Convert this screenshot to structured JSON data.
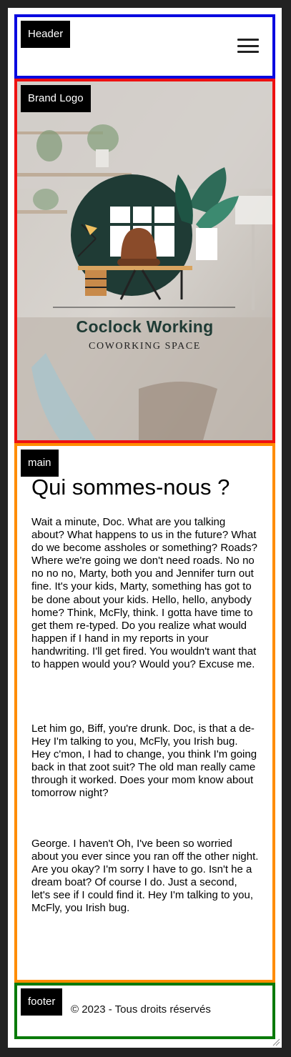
{
  "header": {
    "tag": "Header",
    "menu_icon": "hamburger-menu-icon"
  },
  "brand": {
    "tag": "Brand Logo",
    "title": "Coclock Working",
    "subtitle": "COWORKING SPACE",
    "colors": {
      "circle": "#1f3b35",
      "desk": "#d9a460",
      "chair": "#8a4b2a"
    }
  },
  "main": {
    "tag": "main",
    "title": "Qui sommes-nous ?",
    "paragraphs": [
      "Wait a minute, Doc. What are you talking about? What happens to us in the future? What do we become assholes or something? Roads? Where we're going we don't need roads. No no no no no, Marty, both you and Jennifer turn out fine. It's your kids, Marty, something has got to be done about your kids. Hello, hello, anybody home? Think, McFly, think. I gotta have time to get them re-typed. Do you realize what would happen if I hand in my reports in your handwriting. I'll get fired. You wouldn't want that to happen would you? Would you? Excuse me.",
      "Let him go, Biff, you're drunk. Doc, is that a de- Hey I'm talking to you, McFly, you Irish bug. Hey c'mon, I had to change, you think I'm going back in that zoot suit? The old man really came through it worked. Does your mom know about tomorrow night?",
      "George. I haven't Oh, I've been so worried about you ever since you ran off the other night. Are you okay? I'm sorry I have to go. Isn't he a dream boat? Of course I do. Just a second, let's see if I could find it. Hey I'm talking to you, McFly, you Irish bug."
    ]
  },
  "footer": {
    "tag": "footer",
    "text": "© 2023 - Tous droits réservés"
  },
  "colors": {
    "header_border": "#0a0ae0",
    "brand_border": "#ee1111",
    "main_border": "#ff8c00",
    "footer_border": "#0a7a0a"
  }
}
